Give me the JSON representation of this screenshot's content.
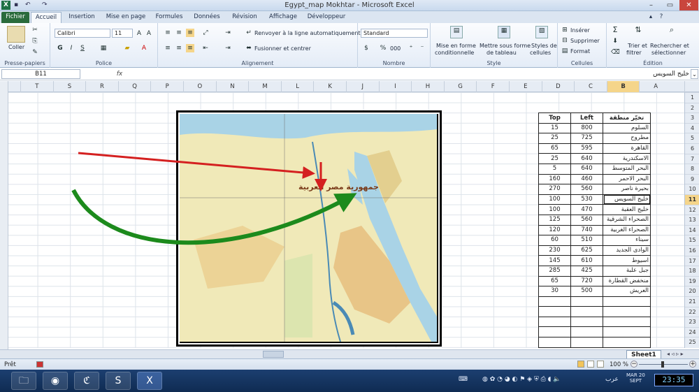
{
  "window": {
    "title": "Egypt_map Mokhtar - Microsoft Excel"
  },
  "tabs": [
    "Fichier",
    "Accueil",
    "Insertion",
    "Mise en page",
    "Formules",
    "Données",
    "Révision",
    "Affichage",
    "Développeur"
  ],
  "ribbon": {
    "clipboard": {
      "label": "Presse-papiers",
      "paste": "Coller"
    },
    "font": {
      "label": "Police",
      "name": "Calibri",
      "size": "11",
      "bold": "G",
      "italic": "I",
      "underline": "S"
    },
    "alignment": {
      "label": "Alignement",
      "wrap": "Renvoyer à la ligne automatiquement",
      "merge": "Fusionner et centrer"
    },
    "number": {
      "label": "Nombre",
      "format": "Standard",
      "percent": "%",
      "thousands": "000"
    },
    "style": {
      "label": "Style",
      "cond1": "Mise en forme",
      "cond2": "conditionnelle",
      "table1": "Mettre sous forme",
      "table2": "de tableau",
      "cell1": "Styles de",
      "cell2": "cellules"
    },
    "cells": {
      "label": "Cellules",
      "insert": "Insérer",
      "delete": "Supprimer",
      "format": "Format"
    },
    "editing": {
      "label": "Édition",
      "sum": "Σ",
      "sort1": "Trier et",
      "sort2": "filtrer",
      "find1": "Rechercher et",
      "find2": "sélectionner"
    }
  },
  "formula_bar": {
    "cell": "B11",
    "fx": "fx",
    "value": "خليج السويس"
  },
  "columns": [
    "T",
    "S",
    "R",
    "Q",
    "P",
    "O",
    "N",
    "M",
    "L",
    "K",
    "J",
    "I",
    "H",
    "G",
    "F",
    "E",
    "D",
    "C",
    "B",
    "A"
  ],
  "selected_col": "B",
  "rows": [
    "1",
    "2",
    "3",
    "4",
    "5",
    "6",
    "7",
    "8",
    "9",
    "10",
    "11",
    "12",
    "13",
    "14",
    "15",
    "16",
    "17",
    "18",
    "19",
    "20",
    "21",
    "22",
    "23",
    "24",
    "25"
  ],
  "selected_row": "11",
  "table": {
    "headers": {
      "top": "Top",
      "left": "Left",
      "name": "تخيّر منطقة"
    },
    "rows": [
      {
        "top": "15",
        "left": "800",
        "name": "السلوم"
      },
      {
        "top": "25",
        "left": "725",
        "name": "مطروح"
      },
      {
        "top": "65",
        "left": "595",
        "name": "القاهرة"
      },
      {
        "top": "25",
        "left": "640",
        "name": "الاسكندرية"
      },
      {
        "top": "5",
        "left": "640",
        "name": "البحر المتوسط"
      },
      {
        "top": "160",
        "left": "460",
        "name": "البحر الاحمر"
      },
      {
        "top": "270",
        "left": "560",
        "name": "بحيرة ناصر"
      },
      {
        "top": "100",
        "left": "530",
        "name": "خليج السويس"
      },
      {
        "top": "100",
        "left": "470",
        "name": "خليج العقبة"
      },
      {
        "top": "125",
        "left": "560",
        "name": "الصحراء الشرقية"
      },
      {
        "top": "120",
        "left": "740",
        "name": "الصحراء الغربية"
      },
      {
        "top": "60",
        "left": "510",
        "name": "سيناء"
      },
      {
        "top": "230",
        "left": "625",
        "name": "الوادى الجديد"
      },
      {
        "top": "145",
        "left": "610",
        "name": "اسيوط"
      },
      {
        "top": "285",
        "left": "425",
        "name": "جبل علبة"
      },
      {
        "top": "65",
        "left": "720",
        "name": "منخفض القطارة"
      },
      {
        "top": "30",
        "left": "500",
        "name": "العريش"
      }
    ]
  },
  "map": {
    "label": "جمهورية مصر العربية"
  },
  "sheet_tab": "Sheet1",
  "status": {
    "ready": "Prêt",
    "zoom": "100 %"
  },
  "taskbar": {
    "lang": "عرب",
    "date1": "MAR 20",
    "date2": "SEPT",
    "clock": "23:35"
  },
  "colors": {
    "accent": "#2a6b3c",
    "selection": "#f5d58a",
    "arrow_red": "#d42020",
    "arrow_green": "#1c8a1c"
  }
}
